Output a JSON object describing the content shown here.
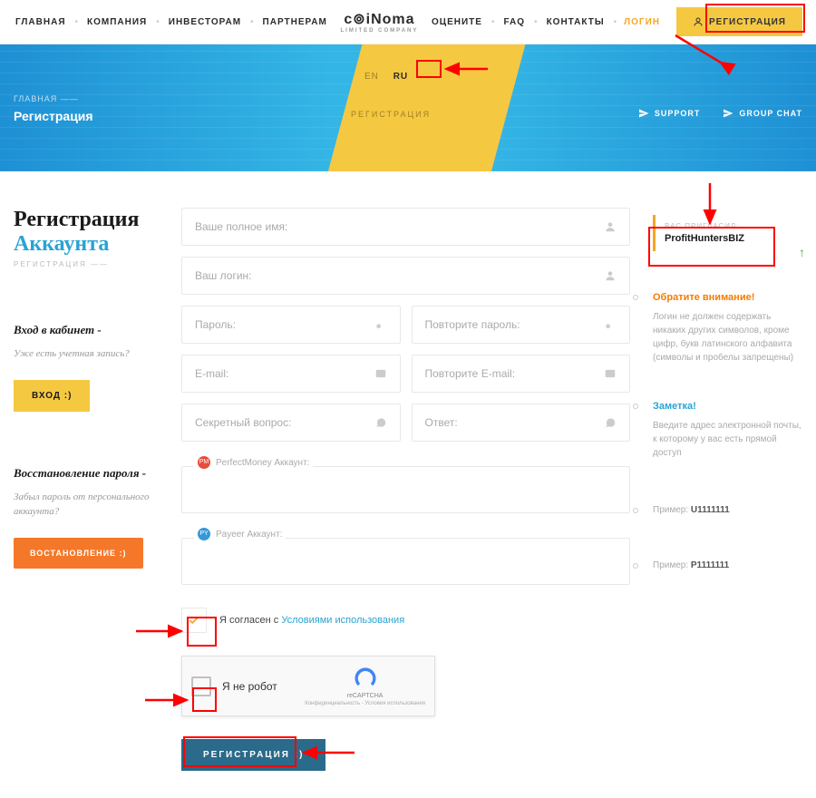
{
  "nav": {
    "left": [
      "ГЛАВНАЯ",
      "КОМПАНИЯ",
      "ИНВЕСТОРАМ",
      "ПАРТНЕРАМ"
    ],
    "right": [
      "ОЦЕНИТЕ",
      "FAQ",
      "КОНТАКТЫ"
    ],
    "login": "ЛОГИН",
    "register": "РЕГИСТРАЦИЯ"
  },
  "logo": {
    "main": "c⊚iNoma",
    "sub": "LIMITED COMPANY"
  },
  "hero": {
    "breadcrumb": "ГЛАВНАЯ",
    "title": "Регистрация",
    "lang_en": "EN",
    "lang_ru": "RU",
    "reg_label": "РЕГИСТРАЦИЯ",
    "support": "SUPPORT",
    "group": "GROUP CHAT"
  },
  "page": {
    "h1a": "Регистрация",
    "h1b": "Аккаунта",
    "sub": "РЕГИСТРАЦИЯ ——",
    "login_h": "Вход в кабинет -",
    "login_p": "Уже есть учетная запись?",
    "login_btn": "ВХОД  :)",
    "recover_h": "Восстановление пароля -",
    "recover_p": "Забыл пароль от персонального аккаунта?",
    "recover_btn": "ВОСТАНОВЛЕНИЕ  :)"
  },
  "form": {
    "fullname": "Ваше полное имя:",
    "login": "Ваш логин:",
    "password": "Пароль:",
    "password2": "Повторите пароль:",
    "email": "E-mail:",
    "email2": "Повторите E-mail:",
    "secret": "Секретный вопрос:",
    "answer": "Ответ:",
    "pm_label": "PerfectMoney Аккаунт:",
    "payeer_label": "Payeer Аккаунт:",
    "agree_pre": "Я согласен с ",
    "agree_link": "Условиями использования",
    "captcha": "Я не робот",
    "captcha_brand": "reCAPTCHA",
    "captcha_sub": "Конфиденциальность - Условия использования",
    "submit": "РЕГИСТРАЦИЯ  :)"
  },
  "aside": {
    "ref_label": "ВАС ПРИГЛАСИЛ:",
    "ref_name": "ProfitHuntersBIZ",
    "note1_t": "Обратите внимание!",
    "note1": "Логин не должен содержать никаких других символов, кроме цифр, букв латинского алфавита (символы и пробелы запрещены)",
    "note2_t": "Заметка!",
    "note2": "Введите адрес электронной почты, к которому у вас есть прямой доступ",
    "ex1_l": "Пример: ",
    "ex1_v": "U1111111",
    "ex2_l": "Пример: ",
    "ex2_v": "P1111111"
  }
}
